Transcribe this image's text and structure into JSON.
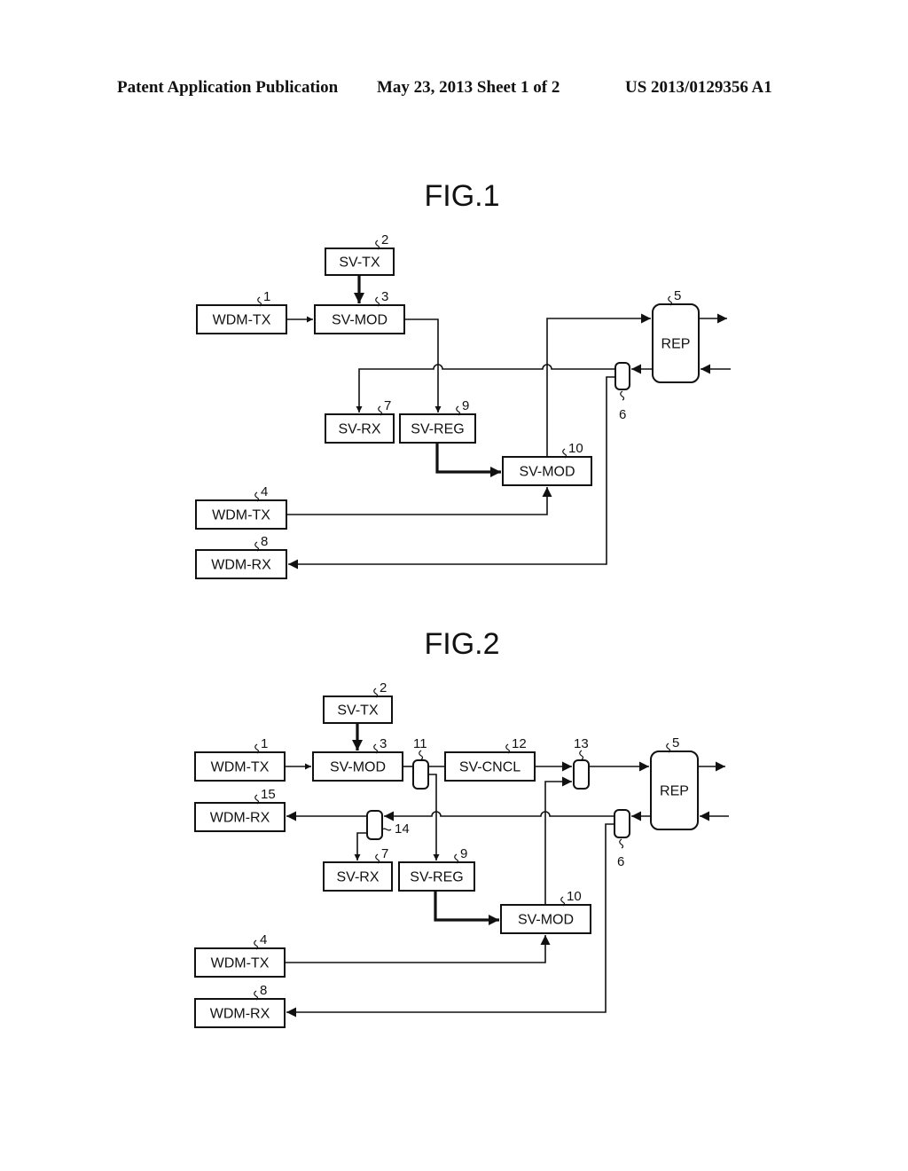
{
  "header": {
    "left": "Patent Application Publication",
    "middle": "May 23, 2013  Sheet 1 of 2",
    "right": "US 2013/0129356 A1"
  },
  "figures": [
    {
      "title": "FIG.1",
      "blocks": [
        {
          "id": "1",
          "label": "WDM-TX",
          "ref": "1"
        },
        {
          "id": "2",
          "label": "SV-TX",
          "ref": "2"
        },
        {
          "id": "3",
          "label": "SV-MOD",
          "ref": "3"
        },
        {
          "id": "5",
          "label": "REP",
          "ref": "5"
        },
        {
          "id": "6",
          "label": "",
          "ref": "6"
        },
        {
          "id": "7",
          "label": "SV-RX",
          "ref": "7"
        },
        {
          "id": "9",
          "label": "SV-REG",
          "ref": "9"
        },
        {
          "id": "10",
          "label": "SV-MOD",
          "ref": "10"
        },
        {
          "id": "4",
          "label": "WDM-TX",
          "ref": "4"
        },
        {
          "id": "8",
          "label": "WDM-RX",
          "ref": "8"
        }
      ]
    },
    {
      "title": "FIG.2",
      "blocks": [
        {
          "id": "1",
          "label": "WDM-TX",
          "ref": "1"
        },
        {
          "id": "2",
          "label": "SV-TX",
          "ref": "2"
        },
        {
          "id": "3",
          "label": "SV-MOD",
          "ref": "3"
        },
        {
          "id": "11",
          "label": "",
          "ref": "11"
        },
        {
          "id": "12",
          "label": "SV-CNCL",
          "ref": "12"
        },
        {
          "id": "13",
          "label": "",
          "ref": "13"
        },
        {
          "id": "5",
          "label": "REP",
          "ref": "5"
        },
        {
          "id": "6",
          "label": "",
          "ref": "6"
        },
        {
          "id": "15",
          "label": "WDM-RX",
          "ref": "15"
        },
        {
          "id": "14",
          "label": "",
          "ref": "14"
        },
        {
          "id": "7",
          "label": "SV-RX",
          "ref": "7"
        },
        {
          "id": "9",
          "label": "SV-REG",
          "ref": "9"
        },
        {
          "id": "10",
          "label": "SV-MOD",
          "ref": "10"
        },
        {
          "id": "4",
          "label": "WDM-TX",
          "ref": "4"
        },
        {
          "id": "8",
          "label": "WDM-RX",
          "ref": "8"
        }
      ]
    }
  ]
}
